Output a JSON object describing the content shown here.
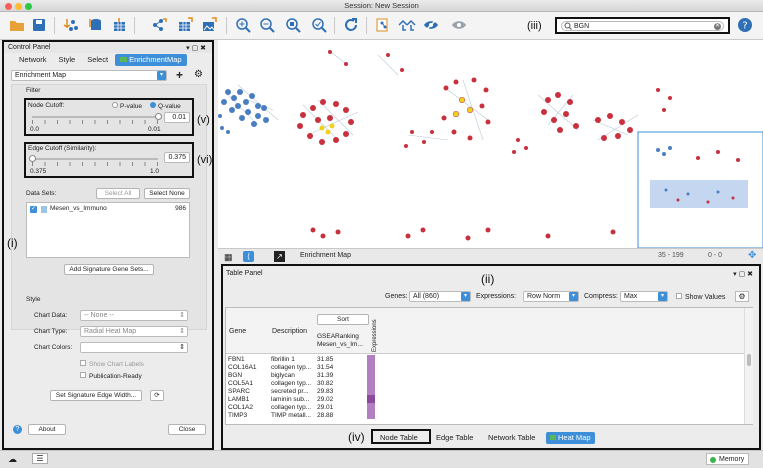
{
  "window": {
    "title": "Session: New Session"
  },
  "search": {
    "value": "BGN"
  },
  "annotations": {
    "i": "(i)",
    "ii": "(ii)",
    "iii": "(iii)",
    "iv": "(iv)",
    "v": "(v)",
    "vi": "(vi)"
  },
  "control_panel": {
    "title": "Control Panel",
    "tabs": [
      "Network",
      "Style",
      "Select",
      "EnrichmentMap"
    ],
    "app_select": "Enrichment Map",
    "filter_label": "Filter",
    "node_cutoff": {
      "label": "Node Cutoff:",
      "opt1": "P-value",
      "opt2": "Q-value",
      "value": "0.01",
      "min": "0.0",
      "max": "0.01",
      "level": 1.0
    },
    "edge_cutoff": {
      "label": "Edge Cutoff (Similarity):",
      "value": "0.375",
      "min": "0.375",
      "max": "1.0",
      "level": 0.0
    },
    "datasets": {
      "label": "Data Sets:",
      "select_all": "Select All",
      "select_none": "Select None",
      "items": [
        {
          "name": "Mesen_vs_Immuno",
          "count": "986"
        }
      ]
    },
    "add_signature": "Add Signature Gene Sets...",
    "style": {
      "label": "Style",
      "chart_data_label": "Chart Data:",
      "chart_data_value": "-- None --",
      "chart_type_label": "Chart Type:",
      "chart_type_value": "Radial Heat Map",
      "chart_colors_label": "Chart Colors:",
      "show_chart_labels": "Show Chart Labels",
      "publication_ready": "Publication-Ready",
      "set_edge_width": "Set Signature Edge Width..."
    },
    "about": "About",
    "close": "Close"
  },
  "network_view": {
    "tab_label": "Enrichment Map",
    "status": "35 - 199",
    "status2": "0 - 0"
  },
  "table_panel": {
    "title": "Table Panel",
    "genes_label": "Genes:",
    "genes_value": "All (860)",
    "expressions_label": "Expressions:",
    "expressions_value": "Row Norm",
    "compress_label": "Compress:",
    "compress_value": "Max",
    "show_values": "Show Values",
    "sort_label": "Sort",
    "columns": {
      "gene": "Gene",
      "description": "Description",
      "ranking": "GSEARanking",
      "ranking2": "Mesen_vs_Im...",
      "expressions": "Expressions"
    },
    "rows": [
      {
        "gene": "FBN1",
        "desc": "fibrillin 1",
        "score": "31.85"
      },
      {
        "gene": "COL16A1",
        "desc": "collagen typ...",
        "score": "31.54"
      },
      {
        "gene": "BGN",
        "desc": "biglycan",
        "score": "31.39"
      },
      {
        "gene": "COL5A1",
        "desc": "collagen typ...",
        "score": "30.82"
      },
      {
        "gene": "SPARC",
        "desc": "secreted pr...",
        "score": "29.83"
      },
      {
        "gene": "LAMB1",
        "desc": "laminin sub...",
        "score": "29.02"
      },
      {
        "gene": "COL1A2",
        "desc": "collagen typ...",
        "score": "29.01"
      },
      {
        "gene": "TIMP3",
        "desc": "TIMP metall...",
        "score": "28.88"
      }
    ],
    "bottom_tabs": [
      "Node Table",
      "Edge Table",
      "Network Table",
      "Heat Map"
    ]
  },
  "statusbar": {
    "memory": "Memory"
  }
}
